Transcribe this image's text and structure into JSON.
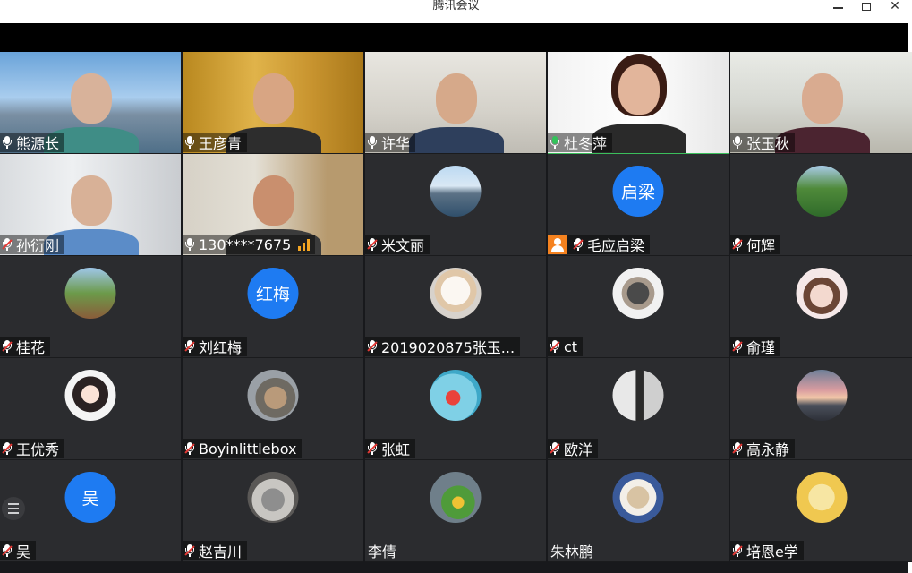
{
  "window": {
    "title": "腾讯会议"
  },
  "participants": [
    {
      "name": "熊源长",
      "mic": "on",
      "type": "video",
      "bg": "sky"
    },
    {
      "name": "王彦青",
      "mic": "on",
      "type": "video",
      "bg": "curtain"
    },
    {
      "name": "许华",
      "mic": "on",
      "type": "video",
      "bg": "office"
    },
    {
      "name": "杜冬萍",
      "mic": "live",
      "type": "video",
      "bg": "bright",
      "active": true
    },
    {
      "name": "张玉秋",
      "mic": "on",
      "type": "video",
      "bg": "shelves"
    },
    {
      "name": "孙衍刚",
      "mic": "muted",
      "type": "video",
      "bg": "whiteboard"
    },
    {
      "name": "130****7675",
      "mic": "on",
      "type": "video",
      "bg": "room",
      "signal": true
    },
    {
      "name": "米文丽",
      "mic": "muted",
      "type": "avatar",
      "avatar": "lake-photo"
    },
    {
      "name": "毛应启梁",
      "mic": "muted",
      "type": "avatar",
      "avatar_text": "启梁",
      "host_badge": true
    },
    {
      "name": "何辉",
      "mic": "muted",
      "type": "avatar",
      "avatar": "field-photo"
    },
    {
      "name": "桂花",
      "mic": "muted",
      "type": "avatar",
      "avatar": "garden-photo"
    },
    {
      "name": "刘红梅",
      "mic": "muted",
      "type": "avatar",
      "avatar_text": "红梅"
    },
    {
      "name": "2019020875张玉...",
      "mic": "muted",
      "type": "avatar",
      "avatar": "kitten-photo"
    },
    {
      "name": "ct",
      "mic": "muted",
      "type": "avatar",
      "avatar": "sphynx-cat-photo"
    },
    {
      "name": "俞瑾",
      "mic": "muted",
      "type": "avatar",
      "avatar": "girl-photo"
    },
    {
      "name": "王优秀",
      "mic": "muted",
      "type": "avatar",
      "avatar": "anime-girl-photo"
    },
    {
      "name": "Boyinlittlebox",
      "mic": "muted",
      "type": "avatar",
      "avatar": "dog-photo"
    },
    {
      "name": "张虹",
      "mic": "muted",
      "type": "avatar",
      "avatar": "ponyo-photo"
    },
    {
      "name": "欧洋",
      "mic": "muted",
      "type": "avatar",
      "avatar": "bw-couple-photo"
    },
    {
      "name": "高永静",
      "mic": "muted",
      "type": "avatar",
      "avatar": "sunset-photo"
    },
    {
      "name": "吴",
      "mic": "muted",
      "type": "avatar",
      "avatar_text": "吴"
    },
    {
      "name": "赵吉川",
      "mic": "muted",
      "type": "avatar",
      "avatar": "cat-on-chair-photo"
    },
    {
      "name": "李倩",
      "mic": "none",
      "type": "avatar",
      "avatar": "flowers-photo"
    },
    {
      "name": "朱林鹏",
      "mic": "none",
      "type": "avatar",
      "avatar": "cat-tie-photo"
    },
    {
      "name": "培恩e学",
      "mic": "muted",
      "type": "avatar",
      "avatar": "cartoon-cat-photo"
    }
  ],
  "colors": {
    "grid_bg": "#18191c",
    "tile_bg": "#2b2c2f",
    "active_border": "#3bbf5c",
    "muted_red": "#e53935",
    "text_avatar_blue": "#1e7bf2",
    "host_badge": "#f5821f"
  },
  "icons": {
    "minimize": "minimize-icon",
    "maximize": "maximize-icon",
    "close": "close-icon",
    "participant_list": "list-icon"
  }
}
